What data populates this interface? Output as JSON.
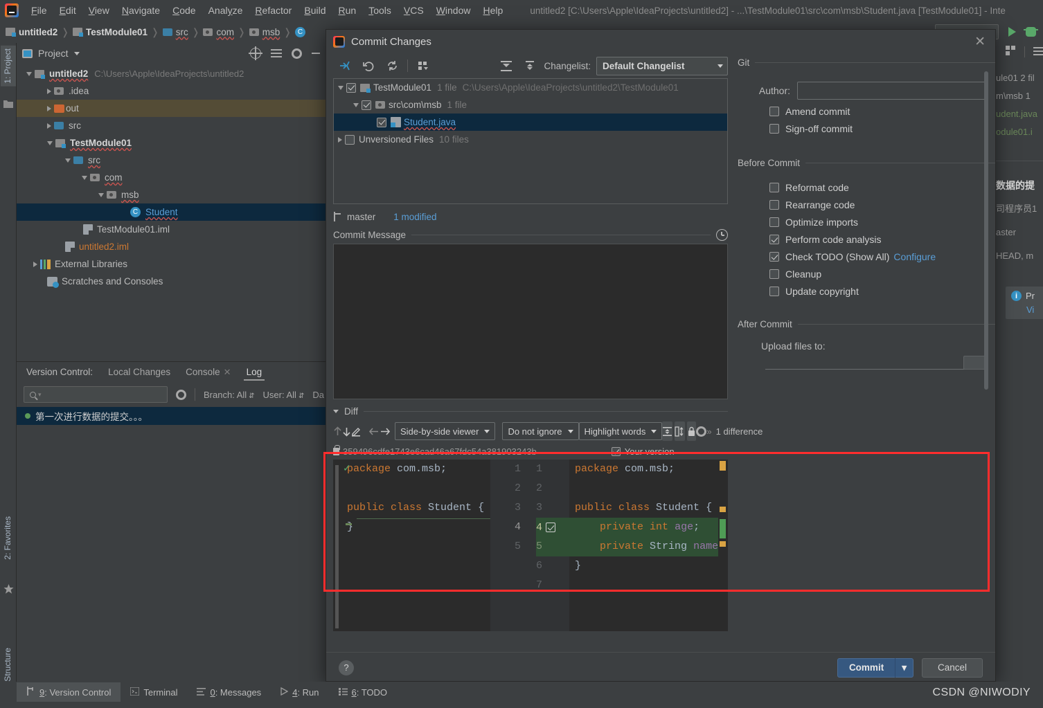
{
  "window": {
    "title": "untitled2 [C:\\Users\\Apple\\IdeaProjects\\untitled2] - ...\\TestModule01\\src\\com\\msb\\Student.java [TestModule01] - Inte"
  },
  "menubar": {
    "items": [
      {
        "label": "File",
        "mnemonic": "F"
      },
      {
        "label": "Edit",
        "mnemonic": "E"
      },
      {
        "label": "View",
        "mnemonic": "V"
      },
      {
        "label": "Navigate",
        "mnemonic": "N"
      },
      {
        "label": "Code",
        "mnemonic": "C"
      },
      {
        "label": "Analyze",
        "mnemonic": "y"
      },
      {
        "label": "Refactor",
        "mnemonic": "R"
      },
      {
        "label": "Build",
        "mnemonic": "B"
      },
      {
        "label": "Run",
        "mnemonic": "R"
      },
      {
        "label": "Tools",
        "mnemonic": "T"
      },
      {
        "label": "VCS",
        "mnemonic": "V"
      },
      {
        "label": "Window",
        "mnemonic": "W"
      },
      {
        "label": "Help",
        "mnemonic": "H"
      }
    ]
  },
  "breadcrumb": {
    "items": [
      {
        "label": "untitled2",
        "icon": "module-icon",
        "bold": true
      },
      {
        "label": "TestModule01",
        "icon": "module-icon",
        "bold": true
      },
      {
        "label": "src",
        "icon": "source-folder-icon",
        "bold": false
      },
      {
        "label": "com",
        "icon": "package-icon",
        "bold": false
      },
      {
        "label": "msb",
        "icon": "package-icon",
        "bold": false
      },
      {
        "label": "C",
        "icon": "class-icon",
        "bold": false
      }
    ]
  },
  "left_strip": {
    "project_tab": "1: Project",
    "favorites_tab": "2: Favorites",
    "structure_tab": "7: Structure"
  },
  "project_panel": {
    "title": "Project",
    "tree": [
      {
        "label": "untitled2",
        "path": "C:\\Users\\Apple\\IdeaProjects\\untitled2",
        "indent": 0,
        "arrow": "down",
        "icon": "module-icon",
        "bold": true,
        "state": "normal"
      },
      {
        "label": ".idea",
        "path": "",
        "indent": 1,
        "arrow": "right",
        "icon": "folder-icon",
        "bold": false,
        "state": "normal"
      },
      {
        "label": "out",
        "path": "",
        "indent": 1,
        "arrow": "right",
        "icon": "excluded-folder-icon",
        "bold": false,
        "state": "highlight"
      },
      {
        "label": "src",
        "path": "",
        "indent": 1,
        "arrow": "right",
        "icon": "source-folder-icon",
        "bold": false,
        "state": "normal"
      },
      {
        "label": "TestModule01",
        "path": "",
        "indent": 1,
        "arrow": "down",
        "icon": "module-icon",
        "bold": true,
        "state": "normal"
      },
      {
        "label": "src",
        "path": "",
        "indent": 2,
        "arrow": "down",
        "icon": "source-folder-icon",
        "bold": false,
        "state": "normal"
      },
      {
        "label": "com",
        "path": "",
        "indent": 3,
        "arrow": "down",
        "icon": "package-icon",
        "bold": false,
        "state": "normal"
      },
      {
        "label": "msb",
        "path": "",
        "indent": 4,
        "arrow": "down",
        "icon": "package-icon",
        "bold": false,
        "state": "normal"
      },
      {
        "label": "Student",
        "path": "",
        "indent": 5,
        "arrow": "none",
        "icon": "class-icon",
        "bold": false,
        "state": "selected"
      },
      {
        "label": "TestModule01.iml",
        "path": "",
        "indent": 3,
        "arrow": "none",
        "icon": "iml-icon",
        "bold": false,
        "state": "normal"
      },
      {
        "label": "untitled2.iml",
        "path": "",
        "indent": 2,
        "arrow": "none",
        "icon": "iml-icon",
        "bold": false,
        "state": "modified"
      },
      {
        "label": "External Libraries",
        "path": "",
        "indent": 0,
        "arrow": "right",
        "icon": "libraries-icon",
        "bold": false,
        "state": "normal"
      },
      {
        "label": "Scratches and Consoles",
        "path": "",
        "indent": 0,
        "arrow": "none",
        "icon": "scratches-icon",
        "bold": false,
        "state": "normal"
      }
    ]
  },
  "version_control_panel": {
    "label": "Version Control:",
    "tabs": [
      {
        "label": "Local Changes",
        "active": false,
        "closable": false
      },
      {
        "label": "Console",
        "active": false,
        "closable": true
      },
      {
        "label": "Log",
        "active": true,
        "closable": false
      }
    ],
    "search_placeholder": "",
    "filters": [
      {
        "label": "Branch: All"
      },
      {
        "label": "User: All"
      },
      {
        "label": "Da"
      }
    ],
    "log_rows": [
      {
        "message": "第一次进行数据的提交。。。"
      }
    ]
  },
  "right_peek": {
    "lines": [
      "ule01  2 fil",
      "m\\msb  1",
      "udent.java",
      "odule01.i",
      "数据的提",
      "司程序员1",
      "aster",
      "HEAD, m"
    ],
    "info_title": "Pr",
    "info_link": "Vi"
  },
  "dialog": {
    "title": "Commit Changes",
    "toolbar_icons": [
      "collapse-selection-icon",
      "revert-icon",
      "refresh-icon",
      "group-by-icon",
      "expand-all-icon",
      "collapse-all-icon"
    ],
    "changelist_label": "Changelist:",
    "changelist_value": "Default Changelist",
    "changes_tree": [
      {
        "label": "TestModule01",
        "count": "1 file",
        "path": "C:\\Users\\Apple\\IdeaProjects\\untitled2\\TestModule01",
        "indent": 0,
        "arrow": "down",
        "checked": true,
        "icon": "module-icon",
        "selected": false
      },
      {
        "label": "src\\com\\msb",
        "count": "1 file",
        "path": "",
        "indent": 1,
        "arrow": "down",
        "checked": true,
        "icon": "folder-icon",
        "selected": false
      },
      {
        "label": "Student.java",
        "count": "",
        "path": "",
        "indent": 2,
        "arrow": "none",
        "checked": true,
        "icon": "java-file-icon",
        "selected": true
      },
      {
        "label": "Unversioned Files",
        "count": "10 files",
        "path": "",
        "indent": 0,
        "arrow": "right",
        "checked": false,
        "icon": "none",
        "selected": false
      }
    ],
    "branch_name": "master",
    "modified_text": "1 modified",
    "commit_message_label": "Commit Message",
    "commit_message_value": "",
    "diff_label": "Diff",
    "diff_toolbar": {
      "viewer_mode": "Side-by-side viewer",
      "ignore_mode": "Do not ignore",
      "highlight_mode": "Highlight words",
      "difference_count": "1 difference",
      "chevron": "»"
    },
    "left_revision": "359496cdfe1743e6cad46a67fdc54a381903243b",
    "right_revision": "Your version",
    "right_revision_checked": true,
    "diff": {
      "left_lines": [
        {
          "num": "",
          "text": "package com.msb;",
          "type": "context"
        },
        {
          "num": "",
          "text": "",
          "type": "context"
        },
        {
          "num": "",
          "text": "public class Student {",
          "type": "context"
        },
        {
          "num": "",
          "text": "}",
          "type": "context"
        }
      ],
      "left_numbers": [
        "1",
        "2",
        "3",
        "4",
        "5",
        "",
        ""
      ],
      "right_numbers": [
        "1",
        "2",
        "3",
        "4",
        "5",
        "6",
        "7"
      ],
      "right_lines": [
        {
          "text": "package com.msb;",
          "type": "context"
        },
        {
          "text": "",
          "type": "context"
        },
        {
          "text": "public class Student {",
          "type": "context"
        },
        {
          "text": "    private int age;",
          "type": "added"
        },
        {
          "text": "    private String name;",
          "type": "added"
        },
        {
          "text": "}",
          "type": "context"
        },
        {
          "text": "",
          "type": "context"
        }
      ]
    },
    "git_group": "Git",
    "author_label": "Author:",
    "author_value": "",
    "git_options": [
      {
        "label": "Amend commit",
        "checked": false
      },
      {
        "label": "Sign-off commit",
        "checked": false
      }
    ],
    "before_commit_group": "Before Commit",
    "before_commit_options": [
      {
        "label": "Reformat code",
        "checked": false,
        "link": ""
      },
      {
        "label": "Rearrange code",
        "checked": false,
        "link": ""
      },
      {
        "label": "Optimize imports",
        "checked": false,
        "link": ""
      },
      {
        "label": "Perform code analysis",
        "checked": true,
        "link": ""
      },
      {
        "label": "Check TODO (Show All)",
        "checked": true,
        "link": "Configure"
      },
      {
        "label": "Cleanup",
        "checked": false,
        "link": ""
      },
      {
        "label": "Update copyright",
        "checked": false,
        "link": ""
      }
    ],
    "after_commit_group": "After Commit",
    "upload_label": "Upload files to:",
    "upload_value": "",
    "help_label": "?",
    "commit_button": "Commit",
    "cancel_button": "Cancel",
    "close_label": "✕"
  },
  "toolwindow_bar": {
    "buttons": [
      {
        "label": "9: Version Control",
        "mnemonic": "9",
        "icon": "vcs-icon",
        "active": true
      },
      {
        "label": "Terminal",
        "mnemonic": "",
        "icon": "terminal-icon",
        "active": false
      },
      {
        "label": "0: Messages",
        "mnemonic": "0",
        "icon": "messages-icon",
        "active": false
      },
      {
        "label": "4: Run",
        "mnemonic": "4",
        "icon": "run-icon",
        "active": false
      },
      {
        "label": "6: TODO",
        "mnemonic": "6",
        "icon": "todo-icon",
        "active": false
      }
    ]
  },
  "watermark": "CSDN @NIWODIY",
  "colors": {
    "accent_blue": "#3592c4",
    "selection": "#0d293e",
    "added_green": "#2f4f34",
    "highlight_red": "#ff2d2d",
    "link": "#5a9ed6",
    "keyword_orange": "#cc7832"
  }
}
